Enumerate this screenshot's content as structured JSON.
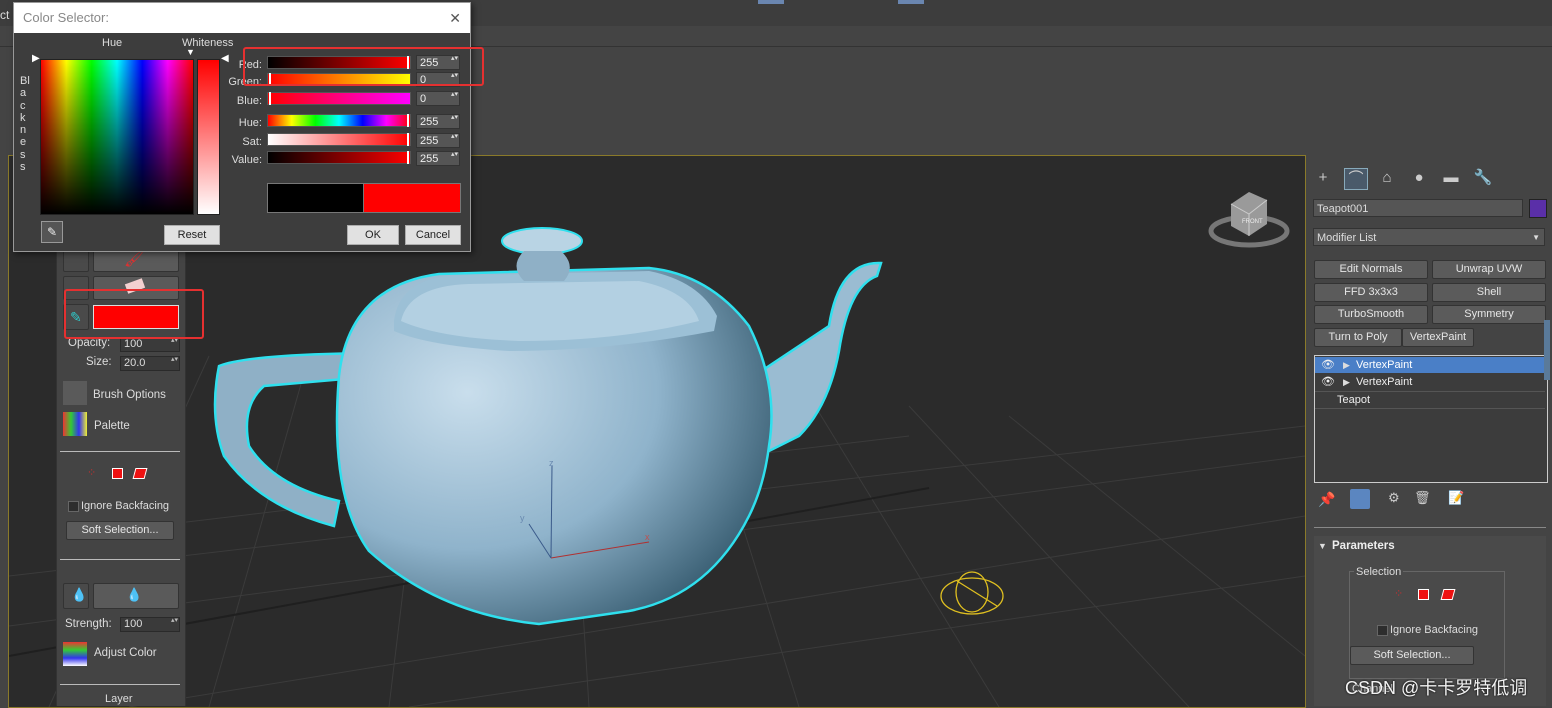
{
  "top_partial_label": "ct",
  "dialog": {
    "title": "Color Selector:",
    "close": "✕",
    "hue_label": "Hue",
    "whiteness_label": "Whiteness",
    "blackness_label": "Blackness",
    "channels": [
      {
        "label": "Red:",
        "value": "255"
      },
      {
        "label": "Green:",
        "value": "0"
      },
      {
        "label": "Blue:",
        "value": "0"
      },
      {
        "label": "Hue:",
        "value": "255"
      },
      {
        "label": "Sat:",
        "value": "255"
      },
      {
        "label": "Value:",
        "value": "255"
      }
    ],
    "reset": "Reset",
    "ok": "OK",
    "cancel": "Cancel",
    "old_color": "#000000",
    "new_color": "#ff0000"
  },
  "left_panel": {
    "paint_color": "#ff0000",
    "opacity_label": "Opacity:",
    "opacity_value": "100",
    "size_label": "Size:",
    "size_value": "20.0",
    "brush_options": "Brush Options",
    "palette": "Palette",
    "ignore_backfacing": "Ignore Backfacing",
    "soft_selection": "Soft Selection...",
    "strength_label": "Strength:",
    "strength_value": "100",
    "adjust_color": "Adjust Color",
    "layer": "Layer"
  },
  "right_panel": {
    "object_name": "Teapot001",
    "object_color": "#5a2fa8",
    "modifier_list": "Modifier List",
    "modifier_buttons": [
      "Edit Normals",
      "Unwrap UVW",
      "FFD 3x3x3",
      "Shell",
      "TurboSmooth",
      "Symmetry",
      "Turn to Poly",
      "VertexPaint"
    ],
    "stack": [
      "VertexPaint",
      "VertexPaint",
      "Teapot"
    ],
    "parameters": "Parameters",
    "selection": "Selection",
    "ignore_backfacing": "Ignore Backfacing",
    "soft_selection": "Soft Selection...",
    "channel": "Channel"
  },
  "viewport": {
    "axis_x": "x",
    "axis_y": "y",
    "axis_z": "z",
    "viewcube_label": "FRONT"
  },
  "watermark": "CSDN @卡卡罗特低调",
  "colors": {
    "highlight_box": "#e53030",
    "selection_outline": "#2fe0ee",
    "teapot": "#a8c8dc"
  }
}
